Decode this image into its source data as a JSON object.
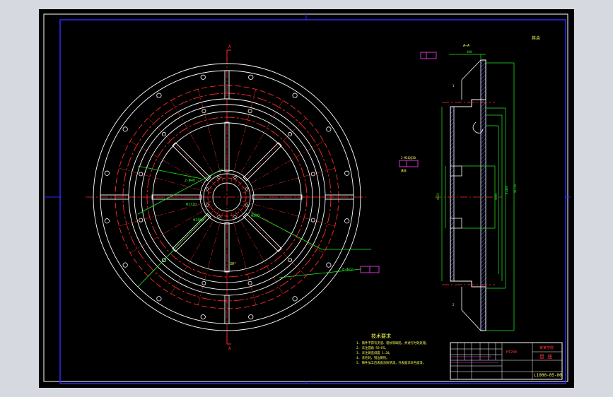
{
  "drawing": {
    "view_label_top": "A",
    "view_label_bottom": "A",
    "section_title": "A—A",
    "corner_note": "其余",
    "tech_title": "技术要求",
    "tech_items": [
      "1. 铸件不得有夹渣、裂纹等缺陷，并进行时效处理。",
      "2. 未注圆角 R3~R5。",
      "3. 未注铸造斜度 1:20。",
      "4. 去毛刺，锐边倒钝。",
      "5. 铸件加工后表面涂防锈漆，外表面涂灰色面漆。"
    ],
    "title_block": {
      "material": "HT200",
      "company": "某某学院",
      "part_name": "盘 座",
      "drawing_no": "L1000-05-00"
    }
  },
  "colors": {
    "background": "#000000",
    "outline": "#ffffff",
    "center_line": "#ff2a2a",
    "dimension": "#22ee22",
    "text": "#ffff55",
    "frame": "#2b2bff",
    "hatch": "#5a5aff"
  }
}
